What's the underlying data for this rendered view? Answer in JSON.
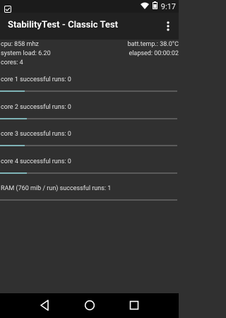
{
  "status_bar": {
    "time": "9:17",
    "icons": [
      "app-notification-icon",
      "wifi-icon",
      "battery-icon"
    ]
  },
  "app_bar": {
    "title": "StabilityTest - Classic Test",
    "menu_icon": "overflow-menu-icon"
  },
  "info": {
    "cpu": "cpu: 858 mhz",
    "system_load": "system load: 6.20",
    "cores": "cores: 4",
    "batt_temp": "batt.temp.: 38.0°C",
    "elapsed": "elapsed: 00:00:02"
  },
  "tests": [
    {
      "label": "core 1 successful runs: 0",
      "progress": 0.14
    },
    {
      "label": "core 2 successful runs: 0",
      "progress": 0.15
    },
    {
      "label": "core 3 successful runs: 0",
      "progress": 0.14
    },
    {
      "label": "core 4 successful runs: 0",
      "progress": 0.15
    },
    {
      "label": "RAM (760 mib / run) successful runs: 1",
      "progress": 0.0
    }
  ],
  "nav_bar": {
    "icons": [
      "back-icon",
      "home-icon",
      "recents-icon"
    ]
  },
  "colors": {
    "background": "#303030",
    "app_bar": "#212121",
    "status_bar": "#1b1b1b",
    "progress_fill": "#7fb3b6",
    "progress_track": "#5a5a5a"
  }
}
